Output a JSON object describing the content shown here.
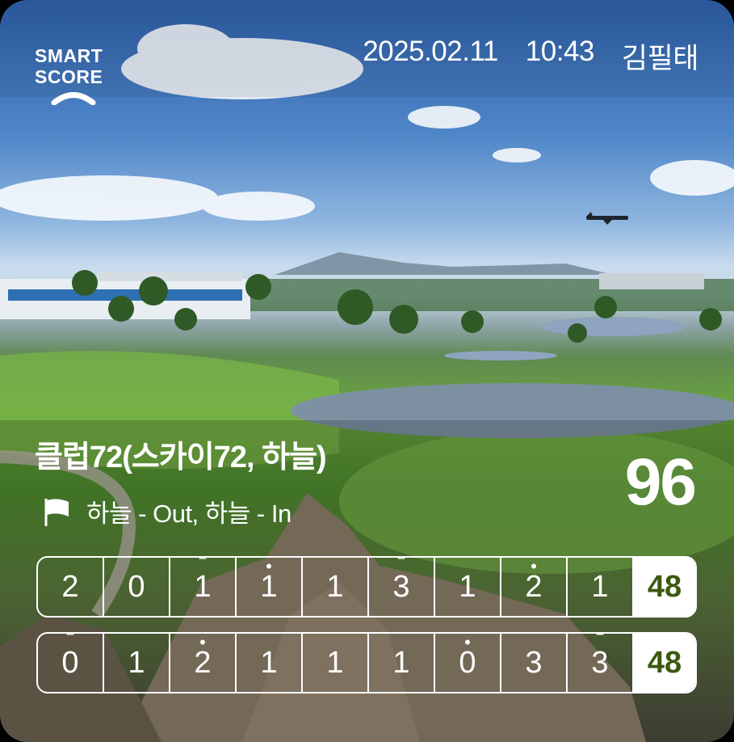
{
  "logo": {
    "line1": "SMART",
    "line2": "SCORE"
  },
  "header": {
    "date": "2025.02.11",
    "time": "10:43",
    "user": "김필태"
  },
  "course": {
    "name": "클럽72(스카이72, 하늘)",
    "sub": "하늘 - Out, 하늘 - In",
    "total": "96"
  },
  "rows": [
    {
      "cells": [
        {
          "v": "2",
          "m": ""
        },
        {
          "v": "0",
          "m": ""
        },
        {
          "v": "1",
          "m": "‾"
        },
        {
          "v": "1",
          "m": "•"
        },
        {
          "v": "1",
          "m": ""
        },
        {
          "v": "3",
          "m": "‾"
        },
        {
          "v": "1",
          "m": ""
        },
        {
          "v": "2",
          "m": "•"
        },
        {
          "v": "1",
          "m": ""
        }
      ],
      "sum": "48"
    },
    {
      "cells": [
        {
          "v": "0",
          "m": "‾"
        },
        {
          "v": "1",
          "m": ""
        },
        {
          "v": "2",
          "m": "•"
        },
        {
          "v": "1",
          "m": ""
        },
        {
          "v": "1",
          "m": ""
        },
        {
          "v": "1",
          "m": ""
        },
        {
          "v": "0",
          "m": "•"
        },
        {
          "v": "3",
          "m": ""
        },
        {
          "v": "3",
          "m": "‾"
        }
      ],
      "sum": "48"
    }
  ],
  "icons": {
    "flag": "flag-icon",
    "logo": "phone-arc-icon"
  },
  "colors": {
    "sum_text": "#3b5a10",
    "text": "#ffffff"
  }
}
